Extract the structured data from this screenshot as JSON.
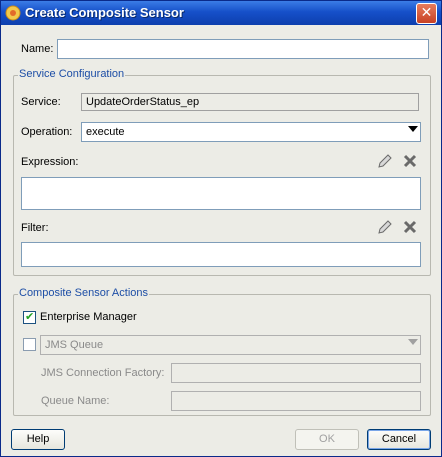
{
  "window": {
    "title": "Create Composite Sensor"
  },
  "name_field": {
    "label": "Name:",
    "value": ""
  },
  "service_config": {
    "legend": "Service Configuration",
    "service_label": "Service:",
    "service_value": "UpdateOrderStatus_ep",
    "operation_label": "Operation:",
    "operation_value": "execute",
    "expression_label": "Expression:",
    "expression_value": "",
    "filter_label": "Filter:",
    "filter_value": ""
  },
  "actions": {
    "legend": "Composite Sensor Actions",
    "enterprise_manager_label": "Enterprise Manager",
    "enterprise_manager_checked": true,
    "jms_checked": false,
    "jms_queue_value": "JMS Queue",
    "jms_factory_label": "JMS Connection Factory:",
    "queue_name_label": "Queue Name:"
  },
  "buttons": {
    "help": "Help",
    "ok": "OK",
    "cancel": "Cancel"
  },
  "icons": {
    "title": "composite-sensor-icon",
    "edit": "pencil-icon",
    "delete": "x-icon"
  }
}
